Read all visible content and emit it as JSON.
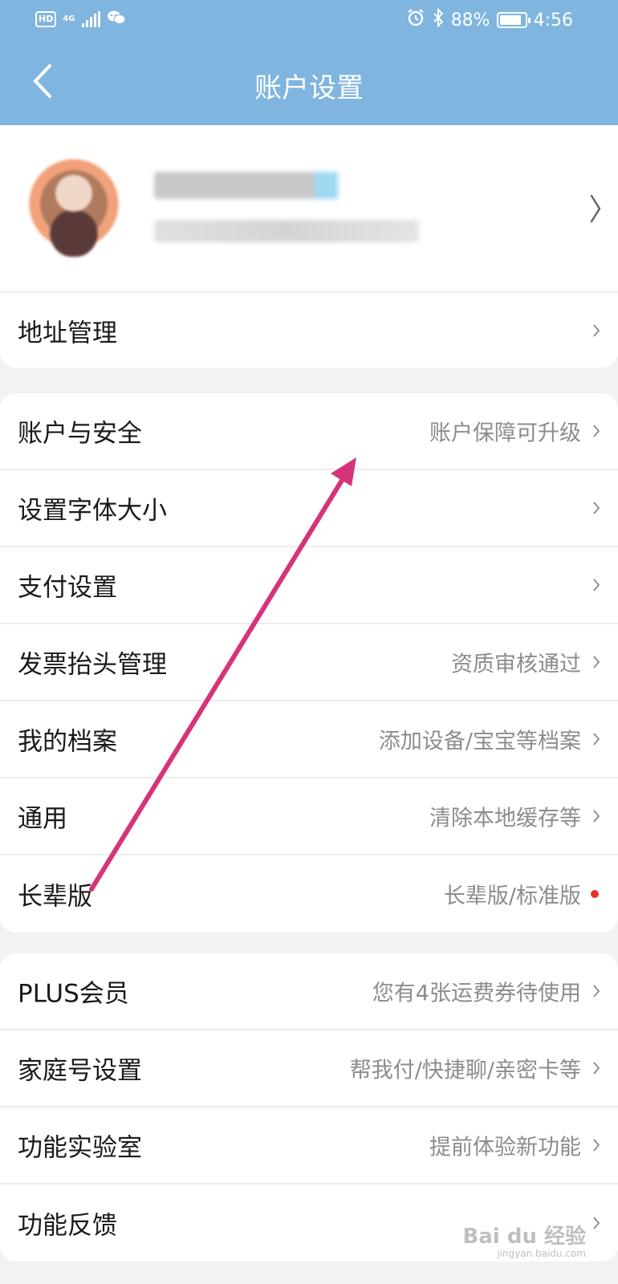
{
  "status_bar": {
    "hd_label": "HD",
    "network_label": "4G",
    "battery_text": "88%",
    "battery_level": 0.88,
    "time": "4:56",
    "icons": [
      "hd-icon",
      "signal-icon",
      "wechat-icon",
      "alarm-icon",
      "bluetooth-icon",
      "battery-icon"
    ]
  },
  "header": {
    "title": "账户设置",
    "back_icon": "chevron-left-icon",
    "background_color": "#7fb5de"
  },
  "profile": {
    "chevron_icon": "chevron-right-icon"
  },
  "group1": {
    "items": [
      {
        "label": "地址管理",
        "hint": ""
      }
    ]
  },
  "group2": {
    "items": [
      {
        "label": "账户与安全",
        "hint": "账户保障可升级"
      },
      {
        "label": "设置字体大小",
        "hint": ""
      },
      {
        "label": "支付设置",
        "hint": ""
      },
      {
        "label": "发票抬头管理",
        "hint": "资质审核通过"
      },
      {
        "label": "我的档案",
        "hint": "添加设备/宝宝等档案"
      },
      {
        "label": "通用",
        "hint": "清除本地缓存等"
      },
      {
        "label": "长辈版",
        "hint": "长辈版/标准版"
      }
    ]
  },
  "group3": {
    "items": [
      {
        "label": "PLUS会员",
        "hint": "您有4张运费券待使用"
      },
      {
        "label": "家庭号设置",
        "hint": "帮我付/快捷聊/亲密卡等"
      },
      {
        "label": "功能实验室",
        "hint": "提前体验新功能"
      },
      {
        "label": "功能反馈",
        "hint": ""
      }
    ]
  },
  "annotation": {
    "arrow_color": "#d6347a"
  },
  "watermark": {
    "brand": "Bai du 经验",
    "url": "jingyan.baidu.com"
  },
  "colors": {
    "notification_dot": "#e5322d"
  }
}
